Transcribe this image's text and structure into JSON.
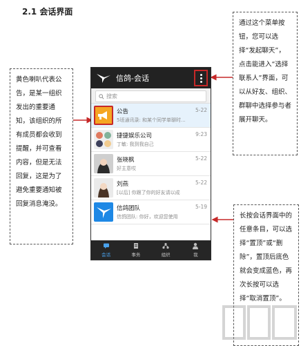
{
  "section_title": "2.1 会话界面",
  "app": {
    "title": "信鸽-会话",
    "search_placeholder": "搜索",
    "accent": "#4aa3ee",
    "topbar_color": "#222222",
    "menu_icon": "more-vertical-icon"
  },
  "conversations": [
    {
      "title": "公告",
      "subtitle": "5班通讯录: 和某个同学单聊时...",
      "time": "5-22",
      "avatar": "megaphone-icon",
      "highlight": true
    },
    {
      "title": "捷捷娱乐公司",
      "subtitle": "丁敏: 我到我自己",
      "time": "9:23",
      "avatar": "group-avatar",
      "highlight": false
    },
    {
      "title": "张晓枫",
      "subtitle": "好主意哎",
      "time": "5-22",
      "avatar": "person-avatar",
      "highlight": false
    },
    {
      "title": "刘燕",
      "subtitle": "[以后] 你跟了你的好友请以成",
      "time": "5-22",
      "avatar": "person-avatar",
      "highlight": false
    },
    {
      "title": "信鸽团队",
      "subtitle": "信鸽团队: 你好，欢迎您使用",
      "time": "5-19",
      "avatar": "pigeon-logo-icon",
      "highlight": false
    }
  ],
  "tabs": [
    {
      "label": "会话",
      "icon": "chat-icon",
      "active": true
    },
    {
      "label": "事务",
      "icon": "task-icon",
      "active": false
    },
    {
      "label": "组织",
      "icon": "org-icon",
      "active": false
    },
    {
      "label": "我",
      "icon": "person-icon",
      "active": false
    }
  ],
  "annotations": {
    "left": "黄色喇叭代表公告，是某一组织发出的重要通知，该组织的所有成员都会收到提醒，并可查看内容，但是无法回复，这是为了避免重要通知被回复消息淹没。",
    "right_top": "通过这个菜单按钮，您可以选择“发起聊天”，点击能进入“选择联系人”界面，可以从好友、组织、群聊中选择参与者展开聊天。",
    "right_bottom": "长按会话界面中的任意条目，可以选择“置顶”或“删除”，置顶后底色就会变成蓝色，再次长按可以选择“取消置顶”。"
  },
  "arrow_color": "#c62828"
}
